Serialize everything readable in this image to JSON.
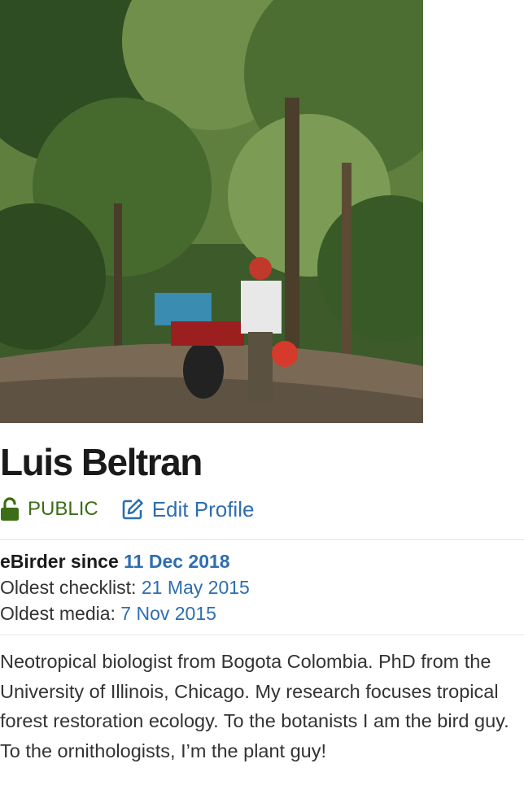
{
  "profile": {
    "photo_alt": "profile-photo",
    "name": "Luis Beltran",
    "visibility_label": "PUBLIC",
    "edit_label": "Edit Profile",
    "ebirder_since_label": "eBirder since",
    "ebirder_since_value": "11 Dec 2018",
    "oldest_checklist_label": "Oldest checklist:",
    "oldest_checklist_value": "21 May 2015",
    "oldest_media_label": "Oldest media:",
    "oldest_media_value": "7 Nov 2015",
    "bio": "Neotropical biologist from Bogota Colombia. PhD from the University of Illinois, Chicago. My research focuses tropical forest restoration ecology. To the botanists I am the bird guy. To the ornithologists, I’m the plant guy!"
  },
  "colors": {
    "accent_link": "#2e6eb0",
    "public_green": "#3b6e16"
  }
}
